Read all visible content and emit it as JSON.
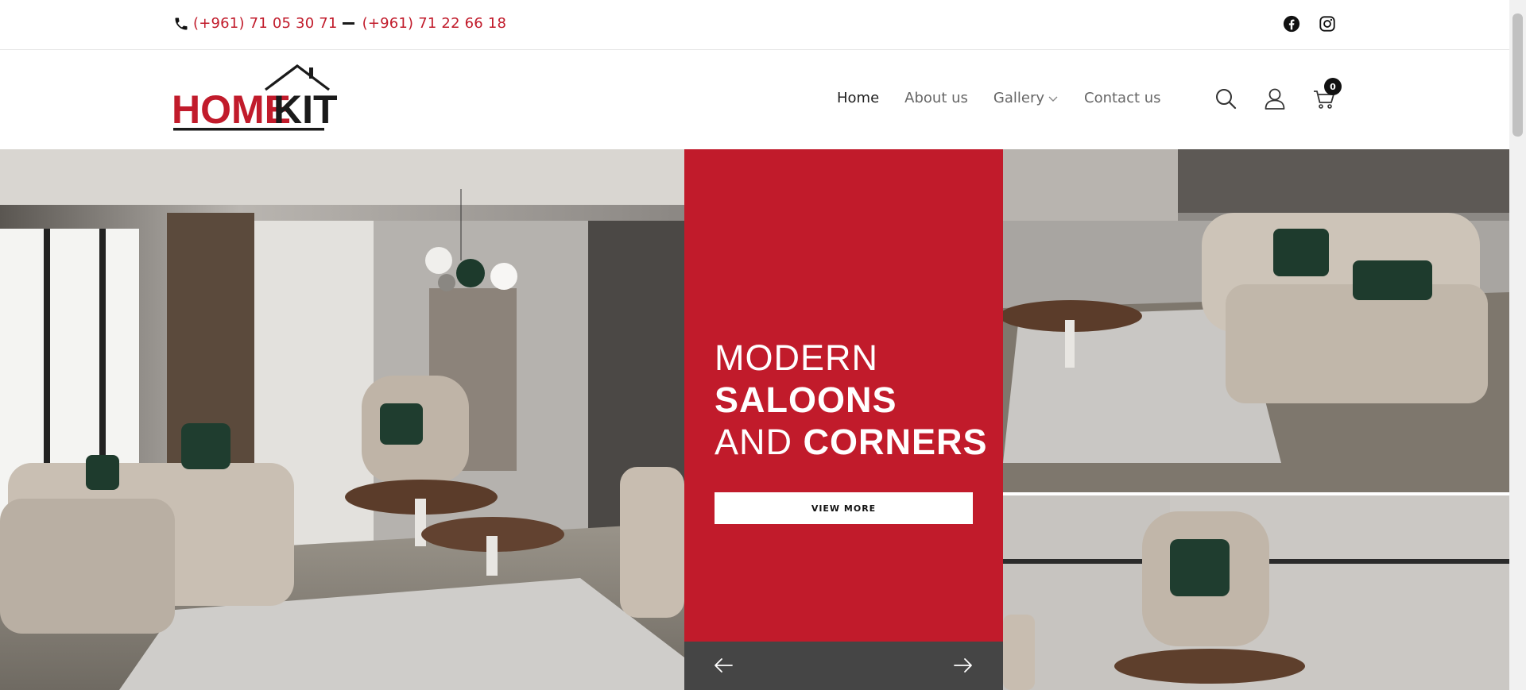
{
  "topbar": {
    "phone1": "(+961) 71 05 30 71",
    "phone2": "(+961) 71 22 66 18",
    "social": [
      {
        "icon": "facebook-icon"
      },
      {
        "icon": "instagram-icon"
      }
    ]
  },
  "header": {
    "logo": {
      "part1": "HOME",
      "part2": "KIT"
    },
    "nav": [
      {
        "label": "Home",
        "active": true
      },
      {
        "label": "About us"
      },
      {
        "label": "Gallery",
        "has_dropdown": true
      },
      {
        "label": "Contact us"
      }
    ],
    "cart_count": "0"
  },
  "hero": {
    "line1": "MODERN",
    "line2": "SALOONS",
    "line3_light": "AND",
    "line3_bold": "CORNERS",
    "button_label": "VIEW MORE"
  },
  "colors": {
    "brand_red": "#c11b2b",
    "dark_gray": "#454545"
  }
}
